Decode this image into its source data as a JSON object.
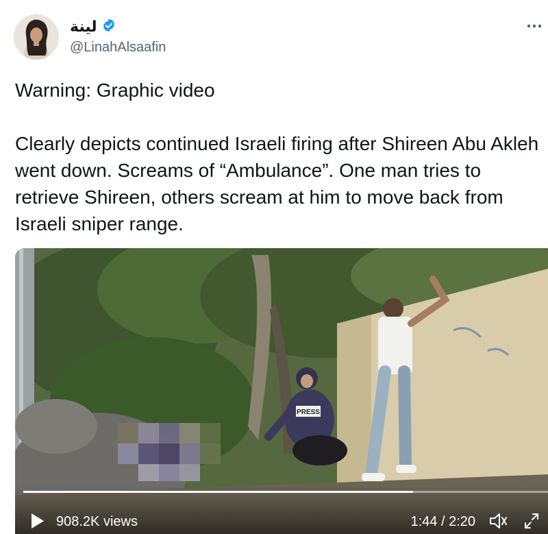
{
  "author": {
    "display_name": "لينة",
    "handle": "@LinahAlsaafin",
    "verified_icon": "verified-badge-icon",
    "verified_color": "#1d9bf0"
  },
  "tweet": {
    "line1": "Warning: Graphic video",
    "line2": "Clearly depicts continued Israeli firing after Shireen Abu Akleh went down. Screams of “Ambulance”. One man tries to retrieve Shireen, others scream at him to move back from Israeli sniper range."
  },
  "video": {
    "views": "908.2K views",
    "time": "1:44 / 2:20",
    "progress": 0.743,
    "vest_label": "PRESS"
  },
  "colors": {
    "text": "#0f1419",
    "secondary": "#536471",
    "accent": "#1d9bf0"
  }
}
